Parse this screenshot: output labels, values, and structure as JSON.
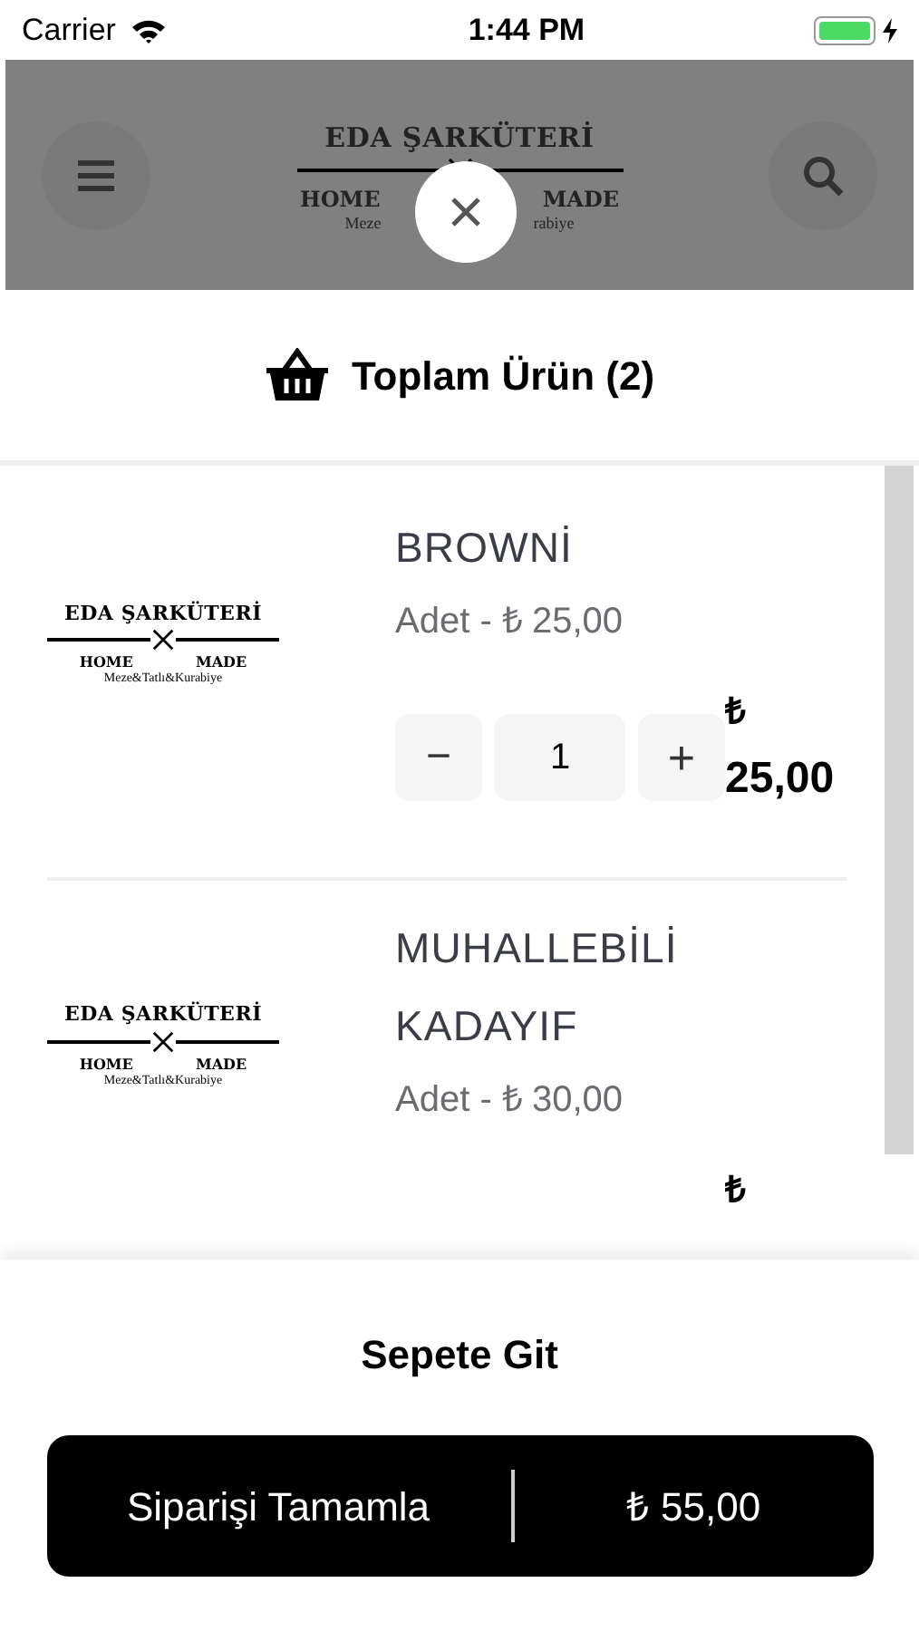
{
  "status_bar": {
    "carrier": "Carrier",
    "time": "1:44 PM"
  },
  "header": {
    "logo": {
      "name": "EDA ŞARKÜTERİ",
      "left": "HOME",
      "right": "MADE",
      "tagline_left": "Meze",
      "tagline_right": "rabiye"
    }
  },
  "sheet": {
    "title": "Toplam Ürün (2)",
    "items": [
      {
        "logo": {
          "name": "EDA ŞARKÜTERİ",
          "left": "HOME",
          "right": "MADE",
          "tagline": "Meze&Tatlı&Kurabiye"
        },
        "name": "BROWNİ",
        "unit_price": "Adet - ₺ 25,00",
        "quantity": "1",
        "minus": "−",
        "plus": "+",
        "currency": "₺",
        "total": "25,00"
      },
      {
        "logo": {
          "name": "EDA ŞARKÜTERİ",
          "left": "HOME",
          "right": "MADE",
          "tagline": "Meze&Tatlı&Kurabiye"
        },
        "name": "MUHALLEBİLİ KADAYIF",
        "unit_price": "Adet - ₺ 30,00",
        "currency": "₺"
      }
    ],
    "go_to_cart": "Sepete Git",
    "checkout": {
      "label": "Siparişi Tamamla",
      "total": "₺ 55,00"
    }
  }
}
